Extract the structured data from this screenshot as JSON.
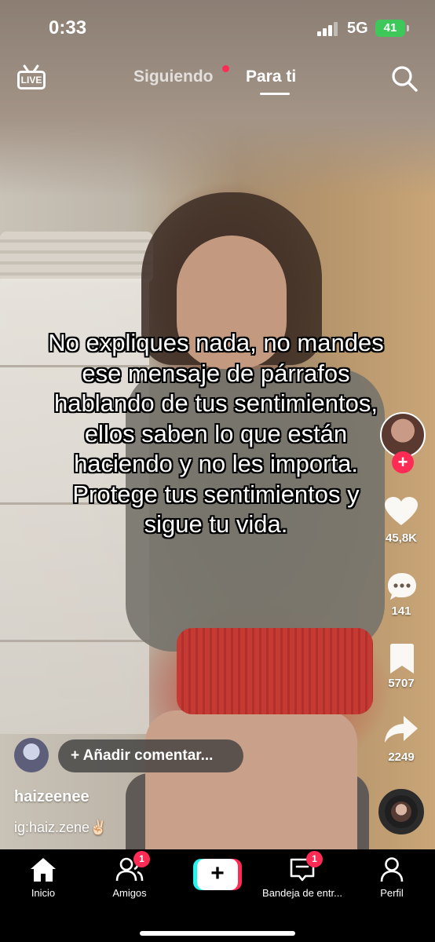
{
  "status_bar": {
    "time": "0:33",
    "network": "5G",
    "battery": "41",
    "battery_color": "#3ec85a"
  },
  "top_nav": {
    "live_label": "LIVE",
    "tabs": [
      {
        "label": "Siguiendo",
        "active": false,
        "has_dot": true
      },
      {
        "label": "Para ti",
        "active": true
      }
    ],
    "search_icon": "search-icon"
  },
  "video": {
    "overlay_text": "No expliques nada, no mandes ese mensaje de párrafos hablando de tus sentimientos, ellos saben lo que están haciendo y no les importa. Protege tus sentimientos y sigue tu vida."
  },
  "actions": {
    "follow_icon": "plus-icon",
    "likes": "45,8K",
    "comments": "141",
    "saves": "5707",
    "shares": "2249"
  },
  "comment_prompt": "+ Añadir comentar...",
  "author": {
    "username": "haizeenee",
    "description": "ig:haiz.zene✌🏻"
  },
  "bottom_nav": {
    "items": [
      {
        "label": "Inicio",
        "icon": "home-icon",
        "active": true
      },
      {
        "label": "Amigos",
        "icon": "friends-icon",
        "badge": "1"
      },
      {
        "label": "",
        "icon": "create-plus-icon"
      },
      {
        "label": "Bandeja de entr...",
        "icon": "inbox-icon",
        "badge": "1"
      },
      {
        "label": "Perfil",
        "icon": "profile-icon"
      }
    ],
    "create_label": "+"
  },
  "colors": {
    "accent_red": "#fe2c55",
    "accent_cyan": "#25f4ee"
  }
}
